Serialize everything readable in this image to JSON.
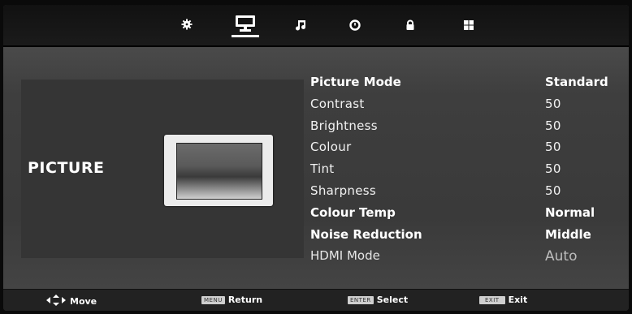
{
  "tabs": [
    {
      "id": "setup",
      "icon": "gear-icon",
      "active": false
    },
    {
      "id": "picture",
      "icon": "monitor-icon",
      "active": true
    },
    {
      "id": "sound",
      "icon": "music-note-icon",
      "active": false
    },
    {
      "id": "time",
      "icon": "clock-icon",
      "active": false
    },
    {
      "id": "lock",
      "icon": "lock-icon",
      "active": false
    },
    {
      "id": "channel",
      "icon": "grid-icon",
      "active": false
    }
  ],
  "section": {
    "title": "PICTURE"
  },
  "menu": [
    {
      "label": "Picture Mode",
      "value": "Standard",
      "style": "strong"
    },
    {
      "label": "Contrast",
      "value": "50",
      "style": "plain"
    },
    {
      "label": "Brightness",
      "value": "50",
      "style": "plain"
    },
    {
      "label": "Colour",
      "value": "50",
      "style": "plain"
    },
    {
      "label": "Tint",
      "value": "50",
      "style": "plain"
    },
    {
      "label": "Sharpness",
      "value": "50",
      "style": "plain"
    },
    {
      "label": "Colour Temp",
      "value": "Normal",
      "style": "strong"
    },
    {
      "label": "Noise Reduction",
      "value": "Middle",
      "style": "strong"
    },
    {
      "label": "HDMI Mode",
      "value": "Auto",
      "style": "dim"
    }
  ],
  "footer": {
    "move": "Move",
    "menu_key": "MENU",
    "return": "Return",
    "enter_key": "ENTER",
    "select": "Select",
    "exit_key": "EXIT",
    "exit": "Exit"
  },
  "colors": {
    "background": "#3b3b3b",
    "topbar": "#151515",
    "text": "#ffffff"
  }
}
